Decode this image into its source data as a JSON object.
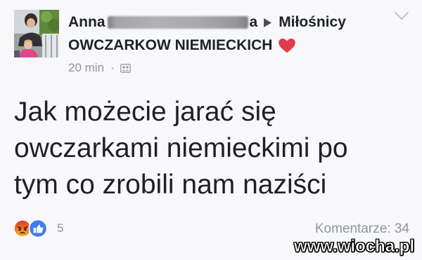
{
  "post": {
    "author": {
      "first_name": "Anna",
      "name_tail": "a"
    },
    "group": {
      "name_line1": "Miłośnicy",
      "name_line2": "OWCZARKOW NIEMIECKICH"
    },
    "meta": {
      "time": "20 min",
      "separator": "·"
    },
    "body_lines": [
      "Jak możecie jarać się",
      "owczarkami niemieckimi po",
      "tym co zrobili nam naziści"
    ],
    "reactions": {
      "types": [
        "angry-reaction-icon",
        "like-reaction-icon"
      ],
      "count": "5"
    },
    "comments": {
      "text": "Komentarze: 34"
    }
  },
  "icons": {
    "shared_to_group": "caret-right-icon",
    "group_emoji": "heart-icon",
    "audience": "group-icon",
    "post_menu": "chevron-down-icon"
  },
  "watermark": "www.wiocha.pl",
  "colors": {
    "name_text": "#1d2129",
    "meta_text": "#90949c",
    "body_text": "#1f2023",
    "heart": "#e23b4c",
    "like_blue": "#3d7cf2",
    "angry_top": "#e2352b",
    "angry_bottom": "#f7b52a",
    "page_bg": "#f8f8fa"
  }
}
